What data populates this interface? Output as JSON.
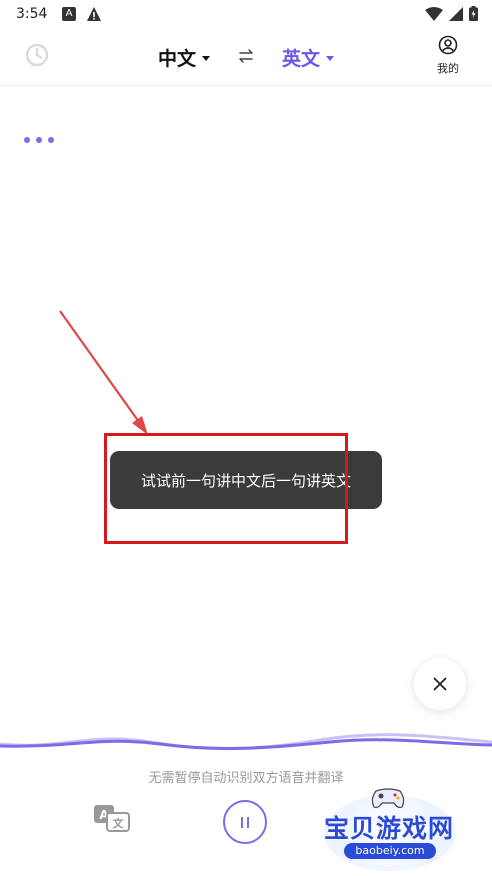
{
  "status_bar": {
    "time": "3:54",
    "app_badge": "A"
  },
  "header": {
    "source_language": "中文",
    "target_language": "英文",
    "profile_label": "我的"
  },
  "toast": {
    "message": "试试前一句讲中文后一句讲英文"
  },
  "footer": {
    "hint": "无需暂停自动识别双方语音并翻译"
  },
  "watermark": {
    "title": "宝贝游戏网",
    "url": "baobeiy.com"
  },
  "colors": {
    "accent": "#6e55e2",
    "toast_bg": "#3b3b3b",
    "annotation_red": "#d6191c"
  }
}
